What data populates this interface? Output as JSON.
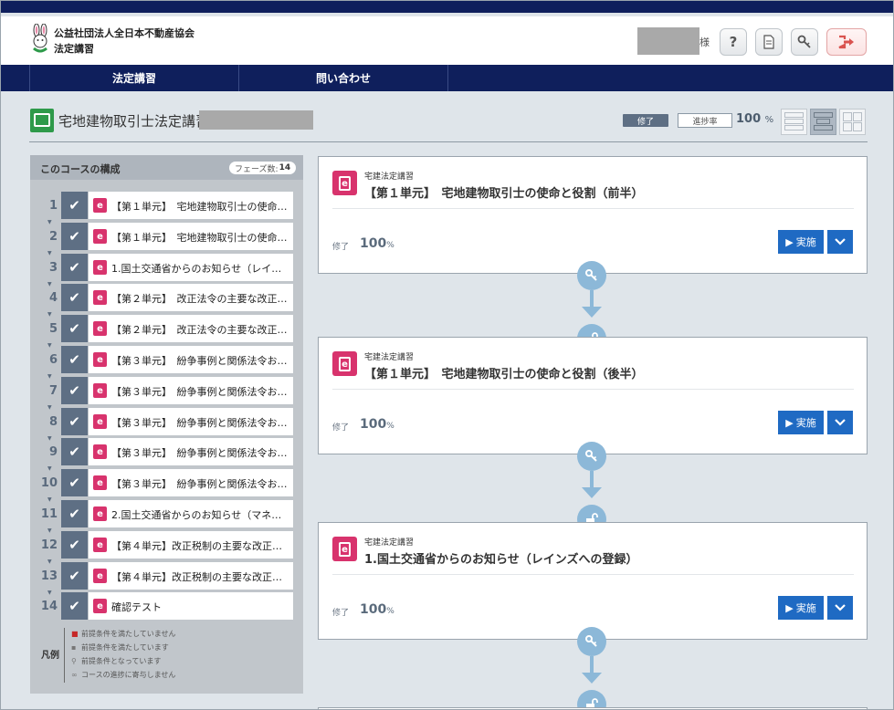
{
  "header": {
    "org_line1": "公益社団法人全日本不動産協会",
    "org_line2": "法定講習",
    "honorific": "様",
    "help_label": "?",
    "buttons": [
      "help-icon",
      "document-icon",
      "key-icon",
      "logout-icon"
    ]
  },
  "nav": {
    "items": [
      {
        "label": "法定講習"
      },
      {
        "label": "問い合わせ"
      }
    ]
  },
  "page": {
    "title": "宅地建物取引士法定講習_",
    "status": "修了",
    "progress_label": "進捗率",
    "progress_value": "100",
    "progress_unit": "%"
  },
  "sidebar": {
    "title": "このコースの構成",
    "phase_label": "フェーズ数:",
    "phase_count": "14",
    "items": [
      {
        "num": "1",
        "label": "【第１単元】　宅地建物取引士の使命…"
      },
      {
        "num": "2",
        "label": "【第１単元】　宅地建物取引士の使命…"
      },
      {
        "num": "3",
        "label": "1.国土交通省からのお知らせ（レイン…"
      },
      {
        "num": "4",
        "label": "【第２単元】　改正法令の主要な改正…"
      },
      {
        "num": "5",
        "label": "【第２単元】　改正法令の主要な改正…"
      },
      {
        "num": "6",
        "label": "【第３単元】　紛争事例と関係法令お…"
      },
      {
        "num": "7",
        "label": "【第３単元】　紛争事例と関係法令お…"
      },
      {
        "num": "8",
        "label": "【第３単元】　紛争事例と関係法令お…"
      },
      {
        "num": "9",
        "label": "【第３単元】　紛争事例と関係法令お…"
      },
      {
        "num": "10",
        "label": "【第３単元】　紛争事例と関係法令お…"
      },
      {
        "num": "11",
        "label": "2.国土交通省からのお知らせ（マネー…"
      },
      {
        "num": "12",
        "label": "【第４単元】改正税制の主要な改正点…"
      },
      {
        "num": "13",
        "label": "【第４単元】改正税制の主要な改正点…"
      },
      {
        "num": "14",
        "label": "確認テスト"
      }
    ],
    "legend": {
      "title": "凡例",
      "items": [
        "前提条件を満たしていません",
        "前提条件を満たしています",
        "前提条件となっています",
        "コースの進捗に寄与しません"
      ]
    }
  },
  "cards": [
    {
      "category": "宅建法定講習",
      "title": "【第１単元】　宅地建物取引士の使命と役割（前半）",
      "status": "修了",
      "percent": "100",
      "unit": "%",
      "run_label": "実施"
    },
    {
      "category": "宅建法定講習",
      "title": "【第１単元】　宅地建物取引士の使命と役割（後半）",
      "status": "修了",
      "percent": "100",
      "unit": "%",
      "run_label": "実施"
    },
    {
      "category": "宅建法定講習",
      "title": "1.国土交通省からのお知らせ（レインズへの登録）",
      "status": "修了",
      "percent": "100",
      "unit": "%",
      "run_label": "実施"
    }
  ],
  "colors": {
    "navy": "#0f1f5c",
    "slate": "#5e6f84",
    "pink": "#d8336d",
    "blue_button": "#1f6ac3",
    "connector": "#8cb8d8",
    "title_icon_green": "#2e9a4a"
  }
}
